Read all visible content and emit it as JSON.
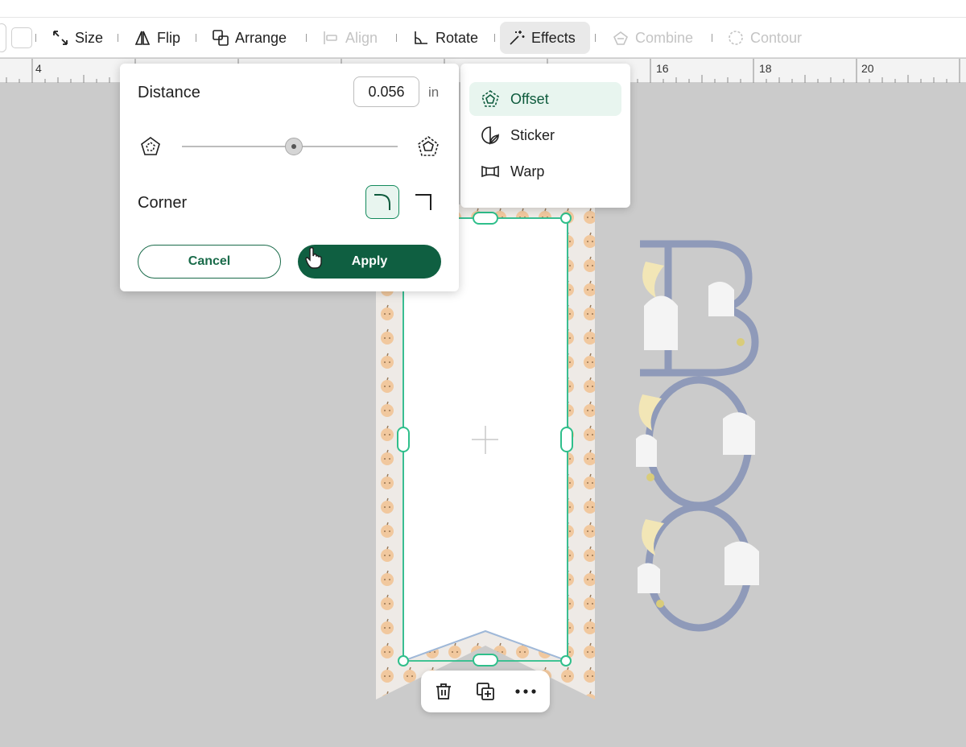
{
  "toolbar": {
    "size_label": "Size",
    "flip_label": "Flip",
    "arrange_label": "Arrange",
    "align_label": "Align",
    "rotate_label": "Rotate",
    "effects_label": "Effects",
    "combine_label": "Combine",
    "contour_label": "Contour"
  },
  "ruler": {
    "labels": [
      "4",
      "16",
      "18",
      "20"
    ]
  },
  "offset_panel": {
    "distance_label": "Distance",
    "distance_value": "0.056",
    "distance_unit": "in",
    "slider_level_fraction": 0.52,
    "corner_label": "Corner",
    "corner_selected": "rounded",
    "cancel_label": "Cancel",
    "apply_label": "Apply"
  },
  "effects_menu": {
    "items": [
      {
        "label": "Offset",
        "icon": "offset-icon",
        "selected": true
      },
      {
        "label": "Sticker",
        "icon": "sticker-icon",
        "selected": false
      },
      {
        "label": "Warp",
        "icon": "warp-icon",
        "selected": false
      }
    ]
  },
  "colors": {
    "accent": "#0f5f41",
    "selection": "#2fbf8b",
    "canvas_bg": "#cbcbcb",
    "menu_selected_bg": "#e8f5ef",
    "letters": "#8f9ab9"
  },
  "object_toolbar": {
    "icons": [
      "trash-icon",
      "duplicate-icon",
      "more-icon"
    ]
  }
}
